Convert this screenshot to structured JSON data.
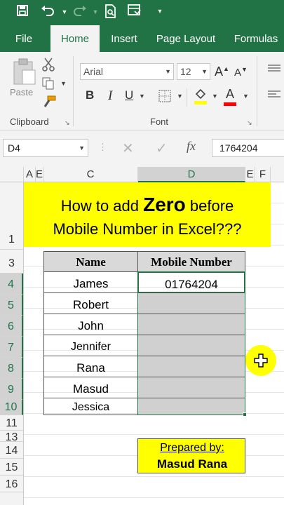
{
  "qat": {
    "icons": [
      "save-icon",
      "undo-icon",
      "redo-icon",
      "print-preview-icon",
      "form-icon",
      "customize-icon"
    ]
  },
  "tabs": [
    {
      "label": "File"
    },
    {
      "label": "Home"
    },
    {
      "label": "Insert"
    },
    {
      "label": "Page Layout"
    },
    {
      "label": "Formulas"
    }
  ],
  "ribbon": {
    "paste_label": "Paste",
    "clipboard_label": "Clipboard",
    "font_label": "Font",
    "font_name": "Arial",
    "font_size": "12",
    "grow_font": "A",
    "shrink_font": "A",
    "bold": "B",
    "italic": "I",
    "underline": "U",
    "font_color_letter": "A",
    "colors": {
      "highlight": "#ffff00",
      "font_color": "#ff0000"
    }
  },
  "formula_bar": {
    "name_box": "D4",
    "fx": "fx",
    "value": "1764204"
  },
  "columns": [
    "A",
    "E",
    "C",
    "D",
    "E",
    "F"
  ],
  "rows": [
    "1",
    "3",
    "4",
    "5",
    "6",
    "7",
    "8",
    "9",
    "10",
    "11",
    "13",
    "14",
    "15",
    "16"
  ],
  "banner": {
    "line1_pre": "How to add ",
    "line1_bold": "Zero",
    "line1_post": " before",
    "line2": "Mobile Number in Excel???"
  },
  "table": {
    "headers": [
      "Name",
      "Mobile Number"
    ],
    "rows": [
      {
        "name": "James",
        "mobile": "01764204"
      },
      {
        "name": "Robert",
        "mobile": ""
      },
      {
        "name": "John",
        "mobile": ""
      },
      {
        "name": "Jennifer",
        "mobile": ""
      },
      {
        "name": "Rana",
        "mobile": ""
      },
      {
        "name": "Masud",
        "mobile": ""
      },
      {
        "name": "Jessica",
        "mobile": ""
      }
    ]
  },
  "prepared": {
    "label": "Prepared by:",
    "author": "Masud Rana"
  },
  "theme": {
    "accent": "#217346",
    "banner": "#ffff00"
  }
}
